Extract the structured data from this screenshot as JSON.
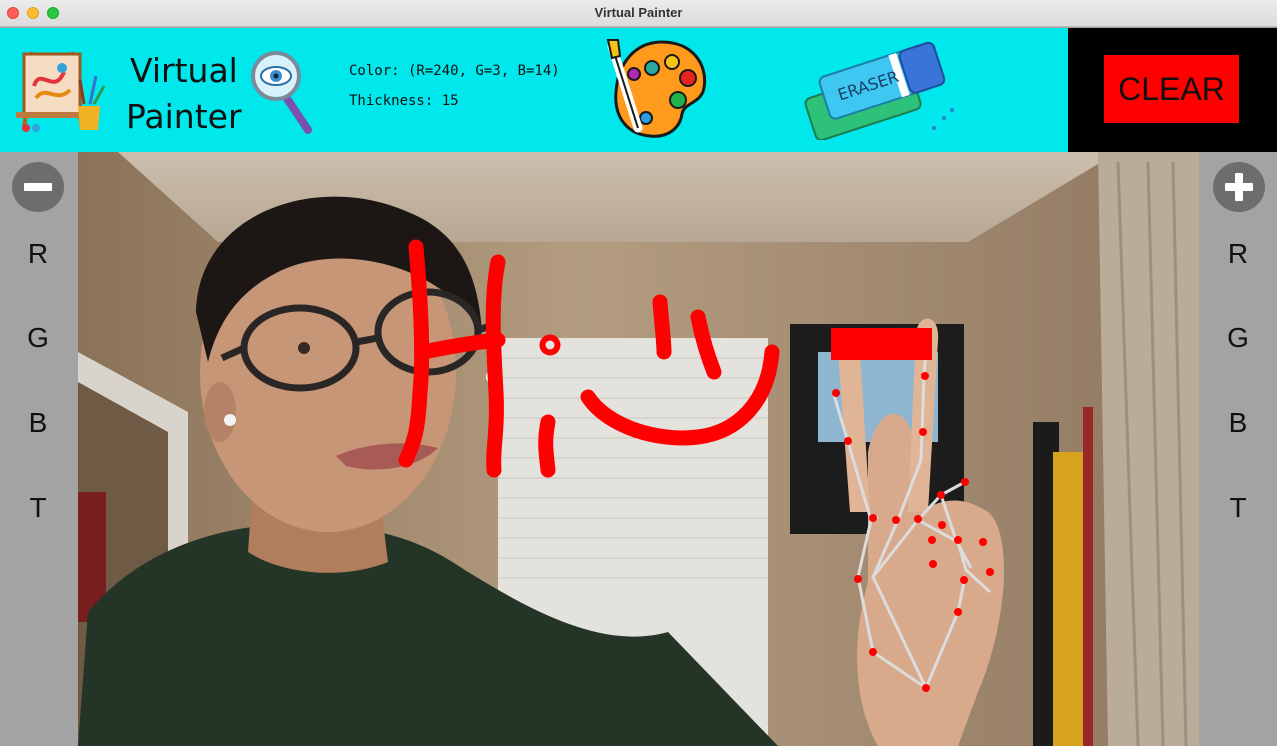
{
  "window": {
    "title": "Virtual Painter"
  },
  "toolbar": {
    "app_name_line1": "Virtual",
    "app_name_line2": "Painter",
    "color_text": "Color: (R=240, G=3, B=14)",
    "thickness_text": "Thickness: 15",
    "eraser_label": "ERASER",
    "clear_label": "CLEAR",
    "icons": [
      "easel-icon",
      "eye-magnifier-icon",
      "palette-icon",
      "eraser-icon"
    ]
  },
  "brush": {
    "r": 240,
    "g": 3,
    "b": 14,
    "thickness": 15,
    "color": "#f0030e"
  },
  "left_panel": {
    "decrease_icon": "minus-icon",
    "channels": [
      "R",
      "G",
      "B",
      "T"
    ]
  },
  "right_panel": {
    "increase_icon": "plus-icon",
    "channels": [
      "R",
      "G",
      "B",
      "T"
    ]
  },
  "colors": {
    "toolbar_bg": "#00e8ec",
    "side_bg": "#a3a3a3",
    "clear_bg": "#ff0000",
    "stroke": "#ff0000"
  }
}
